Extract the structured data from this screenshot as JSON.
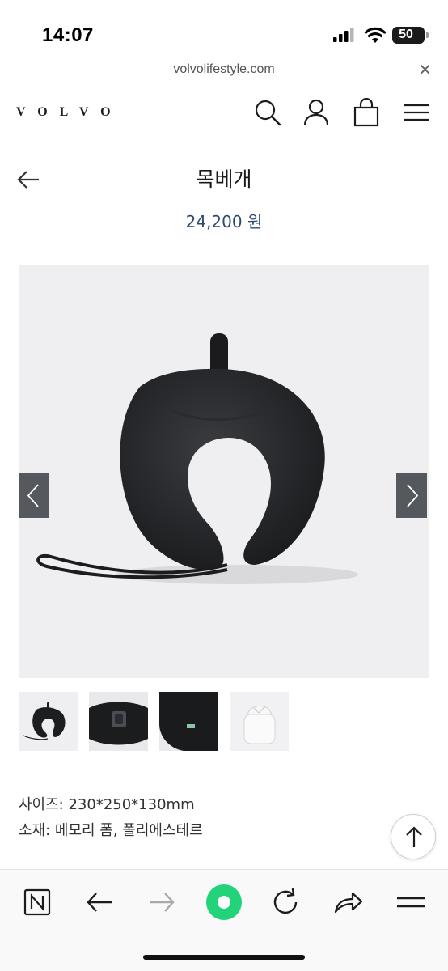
{
  "status_bar": {
    "time": "14:07",
    "battery": "50",
    "icons": [
      "cellular-signal-icon",
      "wifi-icon",
      "battery-icon"
    ]
  },
  "browser": {
    "url": "volvolifestyle.com",
    "close_icon": "close-icon"
  },
  "header": {
    "logo": "VOLVO",
    "icons": [
      "search-icon",
      "account-icon",
      "shopping-bag-icon",
      "menu-icon"
    ]
  },
  "product": {
    "title": "목베개",
    "price": "24,200 원",
    "specs": [
      "사이즈: 230*250*130mm",
      "소재: 메모리 폼, 폴리에스테르"
    ]
  },
  "gallery": {
    "main_image": "neck-pillow-front",
    "thumbnails": [
      "neck-pillow-front",
      "neck-pillow-buckle",
      "neck-pillow-side",
      "neck-pillow-packed"
    ],
    "nav_icons": [
      "chevron-left-icon",
      "chevron-right-icon"
    ]
  },
  "toolbar": {
    "icons": [
      "n-icon",
      "back-arrow-icon",
      "forward-arrow-icon",
      "record-icon",
      "reload-icon",
      "share-icon",
      "menu-icon"
    ],
    "accent": "#22d37a"
  }
}
